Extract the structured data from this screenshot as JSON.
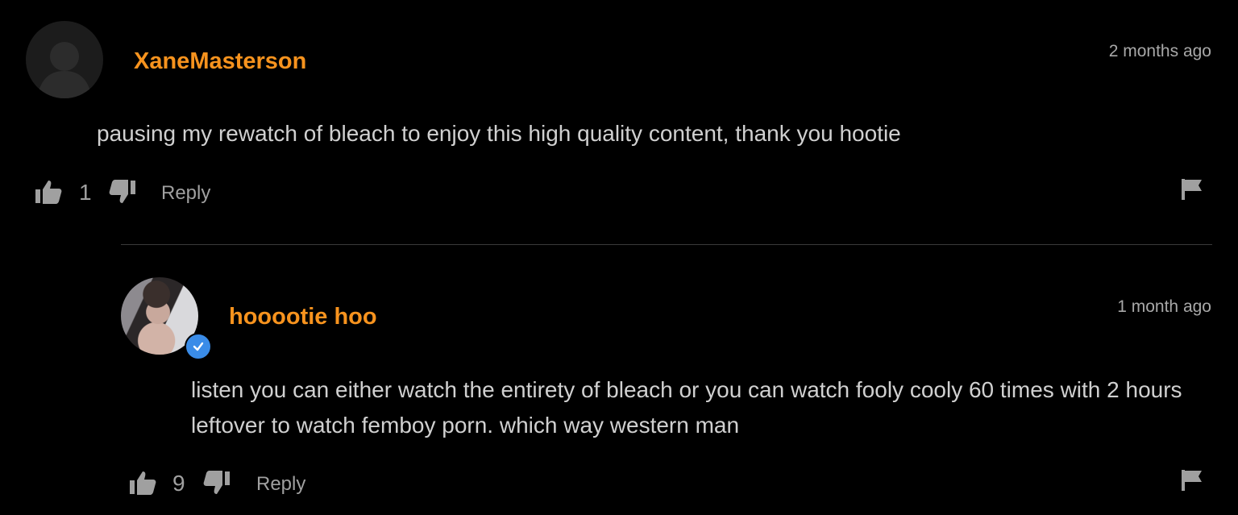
{
  "comments": [
    {
      "username": "XaneMasterson",
      "time": "2 months ago",
      "text": "pausing my rewatch of bleach to enjoy this high quality content, thank you hootie",
      "likes": "1",
      "reply_label": "Reply",
      "avatar": "default-user-silhouette"
    },
    {
      "username": "hooootie hoo",
      "time": "1 month ago",
      "text": "listen you can either watch the entirety of bleach or you can watch fooly cooly 60 times with 2 hours leftover to watch femboy porn. which way western man",
      "likes": "9",
      "reply_label": "Reply",
      "verified": true,
      "avatar": "user-photo"
    }
  ],
  "colors": {
    "background": "#000000",
    "username": "#f7931e",
    "text": "#d0d0d0",
    "meta": "#a0a0a0",
    "verified": "#3a8ce8"
  },
  "icons": [
    "thumbs-up-icon",
    "thumbs-down-icon",
    "flag-icon",
    "verified-check-icon"
  ]
}
